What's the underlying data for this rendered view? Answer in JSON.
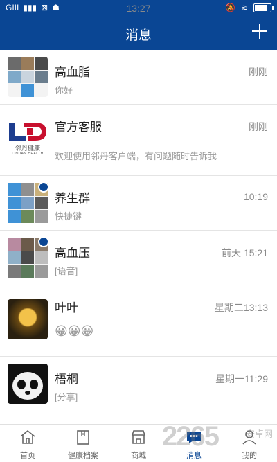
{
  "status_bar": {
    "carrier": "GIII",
    "time": "13:27"
  },
  "header": {
    "title": "消息"
  },
  "conversations": [
    {
      "name": "高血脂",
      "message": "你好",
      "time": "刚刚"
    },
    {
      "name": "官方客服",
      "message": "欢迎使用邻丹客户端，有问题随时告诉我",
      "time": "刚刚",
      "logo_text": "邻丹健康",
      "logo_sub": "LINDAN HEALTH"
    },
    {
      "name": "养生群",
      "message": "快捷键",
      "time": "10:19"
    },
    {
      "name": "高血压",
      "message": "[语音]",
      "time": "前天 15:21"
    },
    {
      "name": "叶叶",
      "message": "",
      "time": "星期二13:13",
      "emoji": "😀😀😀"
    },
    {
      "name": "梧桐",
      "message": "[分享]",
      "time": "星期一11:29"
    }
  ],
  "tabs": [
    {
      "label": "首页",
      "icon": "home-icon"
    },
    {
      "label": "健康档案",
      "icon": "archive-icon"
    },
    {
      "label": "商城",
      "icon": "shop-icon"
    },
    {
      "label": "消息",
      "icon": "chat-icon",
      "active": true
    },
    {
      "label": "我的",
      "icon": "profile-icon"
    }
  ],
  "watermark": {
    "big": "2265",
    "small": "安卓网"
  },
  "colors": {
    "primary": "#0a4694",
    "text": "#222222",
    "muted": "#9a9a9a"
  }
}
